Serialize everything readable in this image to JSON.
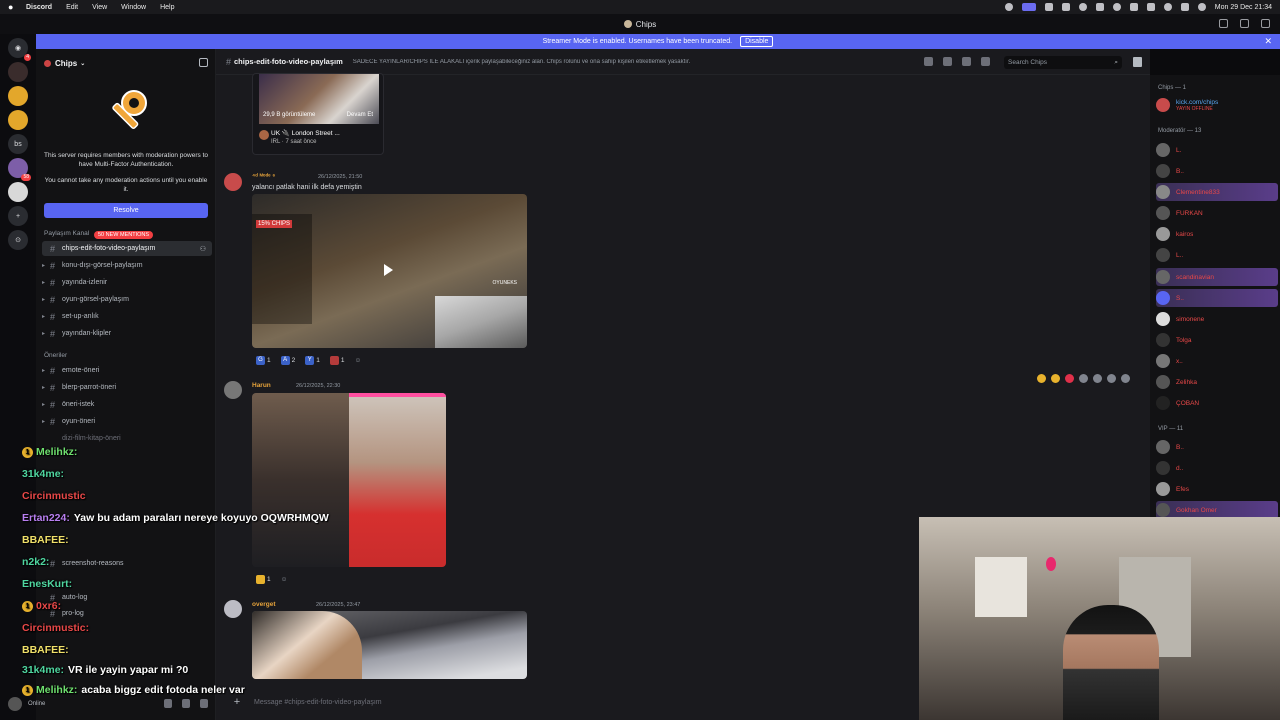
{
  "menubar": {
    "app": "Discord",
    "items": [
      "Edit",
      "View",
      "Window",
      "Help"
    ],
    "clock": "Mon 29 Dec  21:34"
  },
  "window": {
    "title": "Chips"
  },
  "banner": {
    "text": "Streamer Mode is enabled. Usernames have been truncated.",
    "disable_label": "Disable"
  },
  "rail": {
    "servers": [
      "",
      "",
      "",
      "",
      "bs",
      "",
      "",
      "",
      ""
    ],
    "badges": [
      "4",
      "",
      "",
      "",
      "",
      "58",
      "",
      "",
      ""
    ]
  },
  "sidebar": {
    "server_name": "Chips",
    "mfa_text": "This server requires members with moderation powers to have Multi-Factor Authentication.",
    "mfa_text2": "You cannot take any moderation actions until you enable it.",
    "resolve_label": "Resolve",
    "category1": "Paylaşım Kanal",
    "new_mentions": "50 NEW MENTIONS",
    "channels1": [
      "chips-edit-foto-video-paylaşım",
      "konu-dışı-görsel-paylaşım",
      "yayında-izlenir",
      "oyun-görsel-paylaşım",
      "set-up-anlık",
      "yayından-klipler"
    ],
    "category2": "Öneriler",
    "channels2": [
      "emote-öneri",
      "blerp-parrot-öneri",
      "öneri-istek",
      "oyun-öneri",
      "dizi-film-kitap-öneri"
    ],
    "channels3": [
      "screenshot-reasons",
      "auto-log",
      "pro-log"
    ]
  },
  "header": {
    "channel": "chips-edit-foto-video-paylaşım",
    "topic": "SADECE YAYINLAR/CHIPS İLE ALAKALI içerik paylaşabileceğiniz alan. Chips rolünü ve ona sahip kişileri etiketlemek yasaktır.",
    "search_placeholder": "Search Chips"
  },
  "embed": {
    "views": "29,9 B görüntüleme",
    "more": "Devam Et",
    "title": "UK 🔌 London Street ...",
    "sub": "IRL · 7 saat önce"
  },
  "messages": [
    {
      "name": "⁴ᵈ ᴹᵒᵈᵉ ⁶",
      "time": "26/12/2025, 21:50",
      "text": "yalancı patlak hani ilk defa yemiştin"
    },
    {
      "name": "Harun",
      "time": "26/12/2025, 22:30",
      "text": ""
    },
    {
      "name": "overget",
      "time": "26/12/2025, 23:47",
      "text": ""
    }
  ],
  "video": {
    "tag": "15% CHIPS",
    "tag2": "OYUNEKS"
  },
  "reactions1": [
    {
      "emoji": "G",
      "count": "1"
    },
    {
      "emoji": "A",
      "count": "2"
    },
    {
      "emoji": "Y",
      "count": "1"
    },
    {
      "emoji": "",
      "count": "1"
    }
  ],
  "reactions2": [
    {
      "emoji": "",
      "count": "1"
    }
  ],
  "composer": {
    "placeholder": "Message #chips-edit-foto-video-paylaşım"
  },
  "members": {
    "group1": "Chips — 1",
    "owner": "kick.com/chips",
    "owner_status": "YAYIN OFFLINE",
    "group2": "Moderatör — 13",
    "mods": [
      "L.",
      "B..",
      "Clementine833",
      "FURKAN",
      "kairos",
      "L..",
      "scandinavian",
      "S..",
      "simonene",
      "Tolga",
      "x..",
      "Zelihka",
      "ÇOBAN"
    ],
    "group3": "VIP — 11",
    "vips": [
      "B..",
      "d..",
      "Efes",
      "Gokhan Omer"
    ]
  },
  "overlay_chat": [
    {
      "user": "Melihkz:",
      "text": "",
      "color": "#6fe06f",
      "badge": "1"
    },
    {
      "user": "31k4me:",
      "text": "",
      "color": "#4fd6a0",
      "badge": ""
    },
    {
      "user": "Circinmustic",
      "text": "",
      "color": "#e84848",
      "badge": ""
    },
    {
      "user": "Ertan224:",
      "text": "Yaw bu adam paraları nereye koyuyo OQWRHMQW",
      "color": "#b87ff0",
      "badge": ""
    },
    {
      "user": "BBAFEE:",
      "text": "",
      "color": "#f0e06a",
      "badge": ""
    },
    {
      "user": "n2k2:",
      "text": "",
      "color": "#4fd6a0",
      "badge": ""
    },
    {
      "user": "EnesKurt:",
      "text": "",
      "color": "#4fd6a0",
      "badge": ""
    },
    {
      "user": "0xr6:",
      "text": "",
      "color": "#e84848",
      "badge": "1"
    },
    {
      "user": "Circinmustic:",
      "text": "",
      "color": "#e84848",
      "badge": ""
    },
    {
      "user": "BBAFEE:",
      "text": "",
      "color": "#f0e06a",
      "badge": ""
    },
    {
      "user": "31k4me:",
      "text": "VR ile yayin yapar mi ?0",
      "color": "#4fd6a0",
      "badge": ""
    },
    {
      "user": "Melihkz:",
      "text": "acaba biggz edit fotoda neler var",
      "color": "#6fe06f",
      "badge": "1"
    }
  ],
  "user_panel": {
    "status": "Online"
  }
}
